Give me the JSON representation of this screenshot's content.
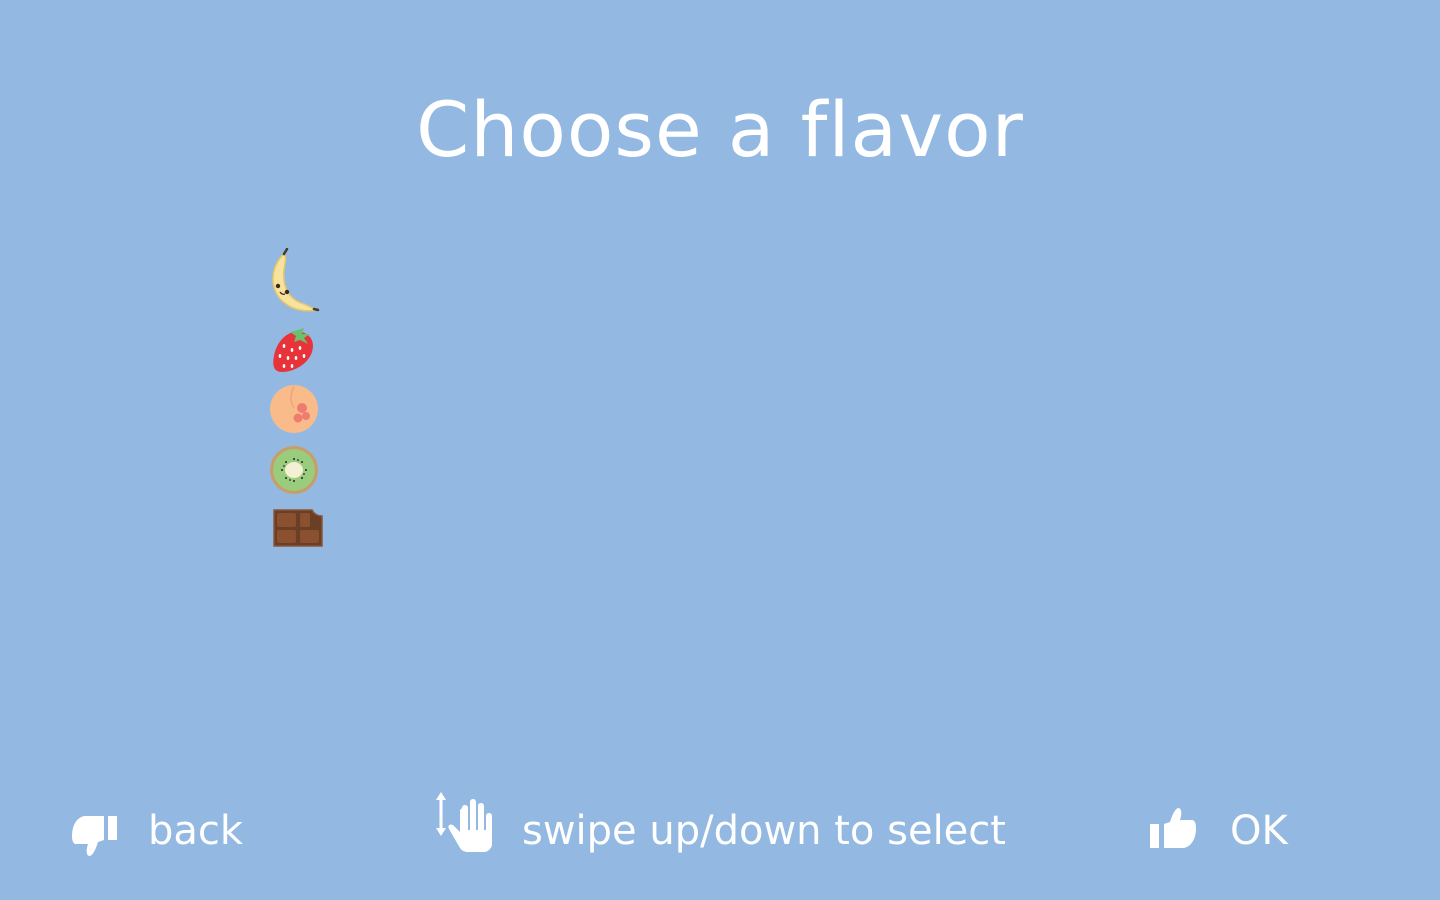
{
  "title": "Choose a flavor",
  "flavors": [
    {
      "name": "banana",
      "icon": "banana-icon"
    },
    {
      "name": "strawberry",
      "icon": "strawberry-icon"
    },
    {
      "name": "peach",
      "icon": "peach-icon"
    },
    {
      "name": "kiwi",
      "icon": "kiwi-icon"
    },
    {
      "name": "chocolate",
      "icon": "chocolate-icon"
    }
  ],
  "footer": {
    "back_label": "back",
    "back_icon": "thumbs-down-icon",
    "swipe_label": "swipe up/down to select",
    "swipe_icon": "swipe-hand-icon",
    "ok_label": "OK",
    "ok_icon": "thumbs-up-icon"
  },
  "colors": {
    "background": "#93b9e3",
    "text": "#ffffff"
  }
}
